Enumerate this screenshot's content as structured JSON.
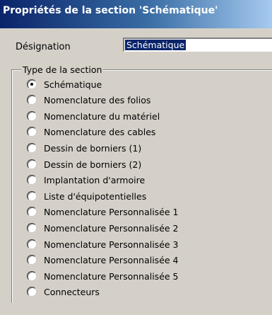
{
  "dialog": {
    "title": "Propriétés de la section 'Schématique'"
  },
  "designation": {
    "label": "Désignation",
    "value": "Schématique"
  },
  "section_type": {
    "legend": "Type de la section",
    "options": [
      {
        "label": "Schématique",
        "checked": true
      },
      {
        "label": "Nomenclature des folios",
        "checked": false
      },
      {
        "label": "Nomenclature du matériel",
        "checked": false
      },
      {
        "label": "Nomenclature des cables",
        "checked": false
      },
      {
        "label": "Dessin de borniers (1)",
        "checked": false
      },
      {
        "label": "Dessin de borniers (2)",
        "checked": false
      },
      {
        "label": "Implantation d'armoire",
        "checked": false
      },
      {
        "label": "Liste d'équipotentielles",
        "checked": false
      },
      {
        "label": "Nomenclature Personnalisée 1",
        "checked": false
      },
      {
        "label": "Nomenclature Personnalisée 2",
        "checked": false
      },
      {
        "label": "Nomenclature Personnalisée 3",
        "checked": false
      },
      {
        "label": "Nomenclature Personnalisée 4",
        "checked": false
      },
      {
        "label": "Nomenclature Personnalisée 5",
        "checked": false
      },
      {
        "label": "Connecteurs",
        "checked": false
      }
    ]
  }
}
